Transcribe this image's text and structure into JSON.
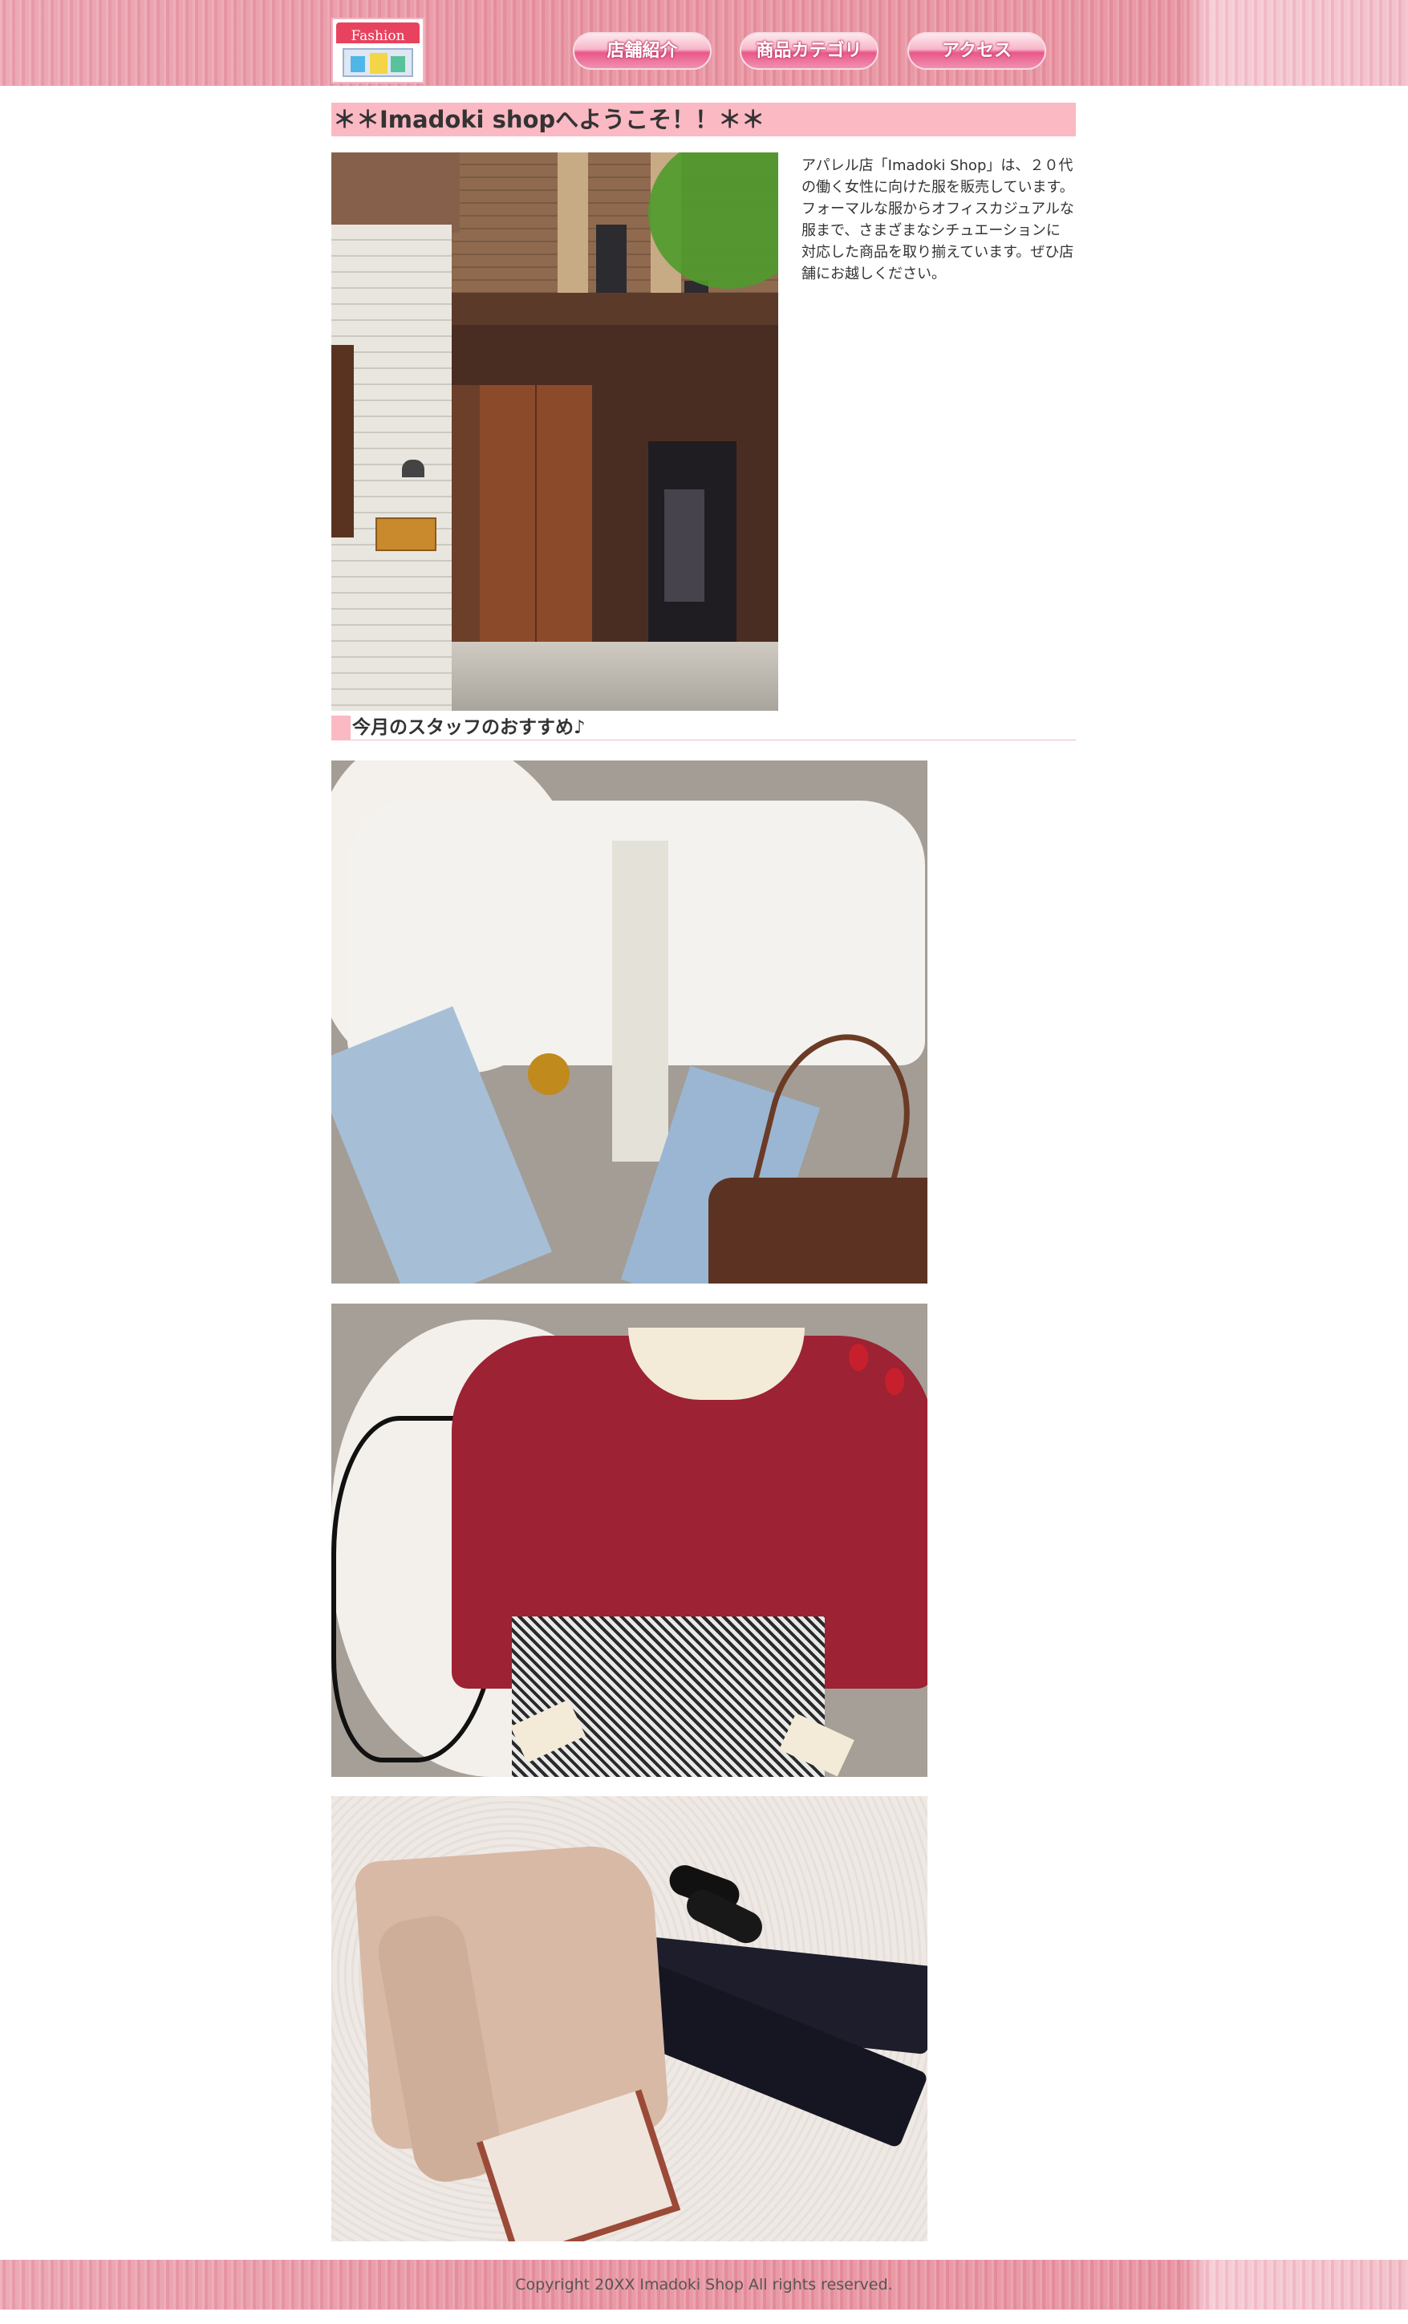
{
  "header": {
    "logo_text": "Fashion",
    "nav": [
      {
        "label": "店舗紹介"
      },
      {
        "label": "商品カテゴリ"
      },
      {
        "label": "アクセス"
      }
    ]
  },
  "main": {
    "title": "＊＊Imadoki shopへようこそ！！＊＊",
    "intro_paragraphs": [
      "アパレル店「Imadoki Shop」は、２０代の働く女性に向けた服を販売しています。",
      "フォーマルな服からオフィスカジュアルな服まで、さまざまなシチュエーションに対応した商品を取り揃えています。ぜひ店舗にお越しください。"
    ],
    "staff_heading": "今月のスタッフのおすすめ♪"
  },
  "footer": {
    "copyright": "Copyright 20XX Imadoki Shop All rights reserved."
  },
  "colors": {
    "accent_pink": "#fbb9c4",
    "header_pink": "#e7919f",
    "nav_pink": "#e9588a"
  }
}
